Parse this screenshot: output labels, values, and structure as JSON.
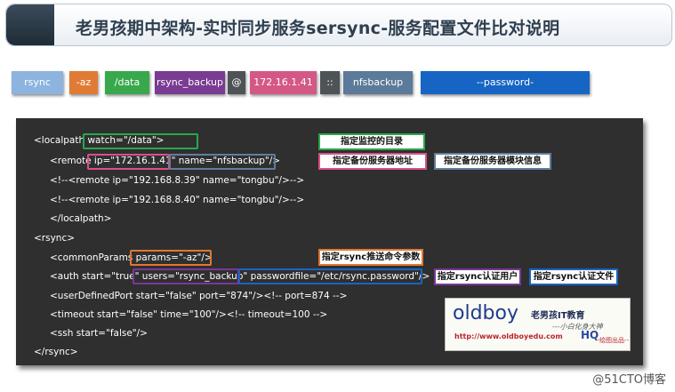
{
  "title": "老男孩期中架构-实时同步服务sersync-服务配置文件比对说明",
  "command": {
    "chips": [
      {
        "label": "rsync",
        "color": "#8cb4de",
        "text_color": "#ffffff"
      },
      {
        "label": "-az",
        "color": "#e07b35",
        "text_color": "#ffffff"
      },
      {
        "label": "/data",
        "color": "#39a84d",
        "text_color": "#ffffff"
      },
      {
        "label": "rsync_backup",
        "color": "#7a3b93",
        "text_color": "#ffffff"
      },
      {
        "label": "@",
        "color": "#4d5356",
        "text_color": "#ffffff"
      },
      {
        "label": "172.16.1.41",
        "color": "#d45885",
        "text_color": "#ffffff"
      },
      {
        "label": "::",
        "color": "#4d5356",
        "text_color": "#ffffff"
      },
      {
        "label": "nfsbackup",
        "color": "#5c7a99",
        "text_color": "#ffffff"
      },
      {
        "label": "--password-file=/etc/rsync.password",
        "color": "#1665c4",
        "text_color": "#ffffff"
      }
    ]
  },
  "config_lines": [
    "<localpath watch=\"/data\">",
    "<remote ip=\"172.16.1.41\" name=\"nfsbackup\"/>",
    "<!--<remote ip=\"192.168.8.39\" name=\"tongbu\"/>-->",
    "<!--<remote ip=\"192.168.8.40\" name=\"tongbu\"/>-->",
    "</localpath>",
    "<rsync>",
    "<commonParams params=\"-az\"/>",
    "<auth start=\"true\" users=\"rsync_backup\" passwordfile=\"/etc/rsync.password\"/>",
    "<userDefinedPort start=\"false\" port=\"874\"/><!-- port=874 -->",
    "<timeout start=\"false\" time=\"100\"/><!-- timeout=100 -->",
    "<ssh start=\"false\"/>",
    "</rsync>"
  ],
  "annotations": {
    "watch_dir": "指定监控的目录",
    "backup_ip": "指定备份服务器地址",
    "backup_module": "指定备份服务器模块信息",
    "push_params": "指定rsync推送命令参数",
    "auth_user": "指定rsync认证用户",
    "auth_file": "指定rsync认证文件"
  },
  "colors": {
    "green": "#27a84a",
    "pink": "#d9508a",
    "slate": "#5f7e9c",
    "orange": "#e0782f",
    "purple": "#7b3895",
    "blue": "#1b63c2"
  },
  "logo": {
    "word": "oldboy",
    "cn_name": "老男孩IT教育",
    "slogan": "---小白化身大神",
    "url": "http://www.oldboyedu.com",
    "hq": "HQ",
    "draw": "--绘图出品--"
  },
  "watermark": "@51CTO博客"
}
